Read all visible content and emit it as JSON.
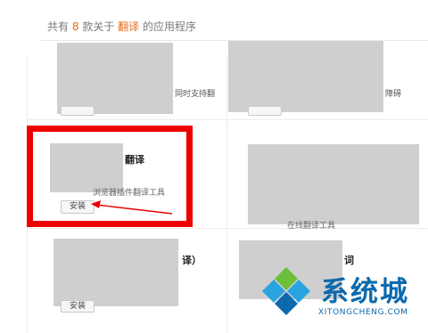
{
  "header": {
    "prefix": "共有",
    "count": "8",
    "middle": "款关于",
    "keyword": "翻译",
    "suffix": "的应用程序"
  },
  "cards": [
    {
      "snippet": "同时支持翻",
      "install_label": ""
    },
    {
      "snippet": "障碍",
      "install_label": ""
    },
    {
      "title": "翻译",
      "snippet": "浏览器插件翻译工具",
      "install_label": "安装"
    },
    {
      "snippet": "在线翻译工具",
      "install_label": ""
    },
    {
      "title": "译）",
      "install_label": "安装"
    },
    {
      "title": "词",
      "install_label": ""
    }
  ],
  "watermark": {
    "brand": "系统城",
    "url": "XITONGCHENG.COM",
    "colors": {
      "blue": "#0c69ae",
      "green": "#6cbf3b",
      "light_blue": "#2aa4e0"
    }
  },
  "annotation": {
    "highlight_color": "#ee0000"
  }
}
